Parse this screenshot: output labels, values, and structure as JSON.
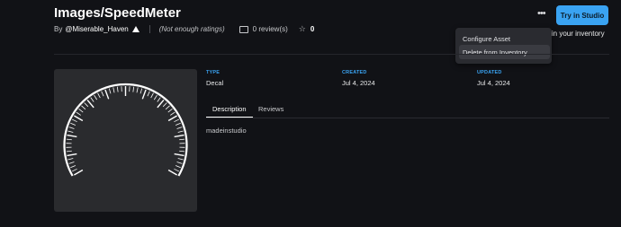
{
  "asset": {
    "title": "Images/SpeedMeter",
    "by_label": "By",
    "creator": "@Miserable_Haven",
    "ratings_text": "(Not enough ratings)",
    "reviews_text": "0 review(s)",
    "favorites_count": "0"
  },
  "header": {
    "more_label": "•••",
    "try_button_label": "Try in Studio",
    "inventory_text": "ble in your inventory"
  },
  "menu": {
    "items": [
      {
        "label": "Configure Asset"
      },
      {
        "label": "Delete from Inventory"
      }
    ]
  },
  "details": {
    "type_label": "TYPE",
    "type_value": "Decal",
    "created_label": "CREATED",
    "created_value": "Jul 4, 2024",
    "updated_label": "UPDATED",
    "updated_value": "Jul 4, 2024"
  },
  "tabs": [
    {
      "label": "Description",
      "active": true
    },
    {
      "label": "Reviews",
      "active": false
    }
  ],
  "description": "madeinstudio",
  "colors": {
    "accent": "#3aa3f2",
    "background": "#111216",
    "menu_bg": "#2a2b30"
  }
}
